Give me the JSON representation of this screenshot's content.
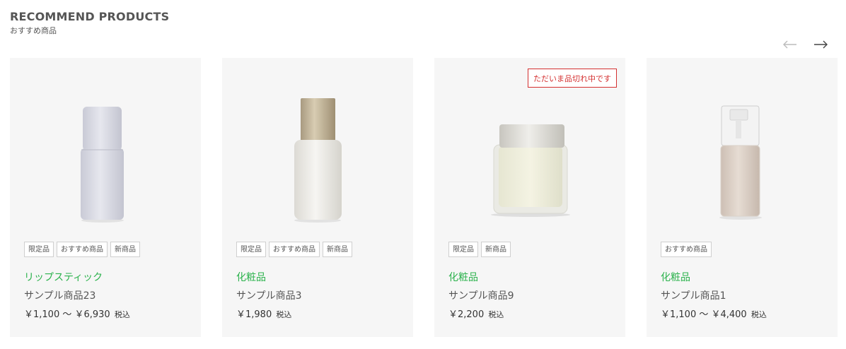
{
  "section": {
    "title": "RECOMMEND PRODUCTS",
    "subtitle": "おすすめ商品"
  },
  "nav": {
    "prev_icon": "arrow-left-icon",
    "next_icon": "arrow-right-icon",
    "prev_color": "#bbbbbb",
    "next_color": "#444444"
  },
  "accent_color": "#2bb24c",
  "soldout_color": "#d43030",
  "products": [
    {
      "tags": [
        "限定品",
        "おすすめ商品",
        "新商品"
      ],
      "category": "リップスティック",
      "name": "サンプル商品23",
      "price": "￥1,100 〜 ￥6,930",
      "tax_label": "税込",
      "image": "lavender-bottle",
      "soldout": ""
    },
    {
      "tags": [
        "限定品",
        "おすすめ商品",
        "新商品"
      ],
      "category": "化粧品",
      "name": "サンプル商品3",
      "price": "￥1,980",
      "tax_label": "税込",
      "image": "white-bottle-gold-cap",
      "soldout": ""
    },
    {
      "tags": [
        "限定品",
        "新商品"
      ],
      "category": "化粧品",
      "name": "サンプル商品9",
      "price": "￥2,200",
      "tax_label": "税込",
      "image": "cream-jar",
      "soldout": "ただいま品切れ中です"
    },
    {
      "tags": [
        "おすすめ商品"
      ],
      "category": "化粧品",
      "name": "サンプル商品1",
      "price": "￥1,100 〜 ￥4,400",
      "tax_label": "税込",
      "image": "pump-bottle",
      "soldout": ""
    }
  ]
}
